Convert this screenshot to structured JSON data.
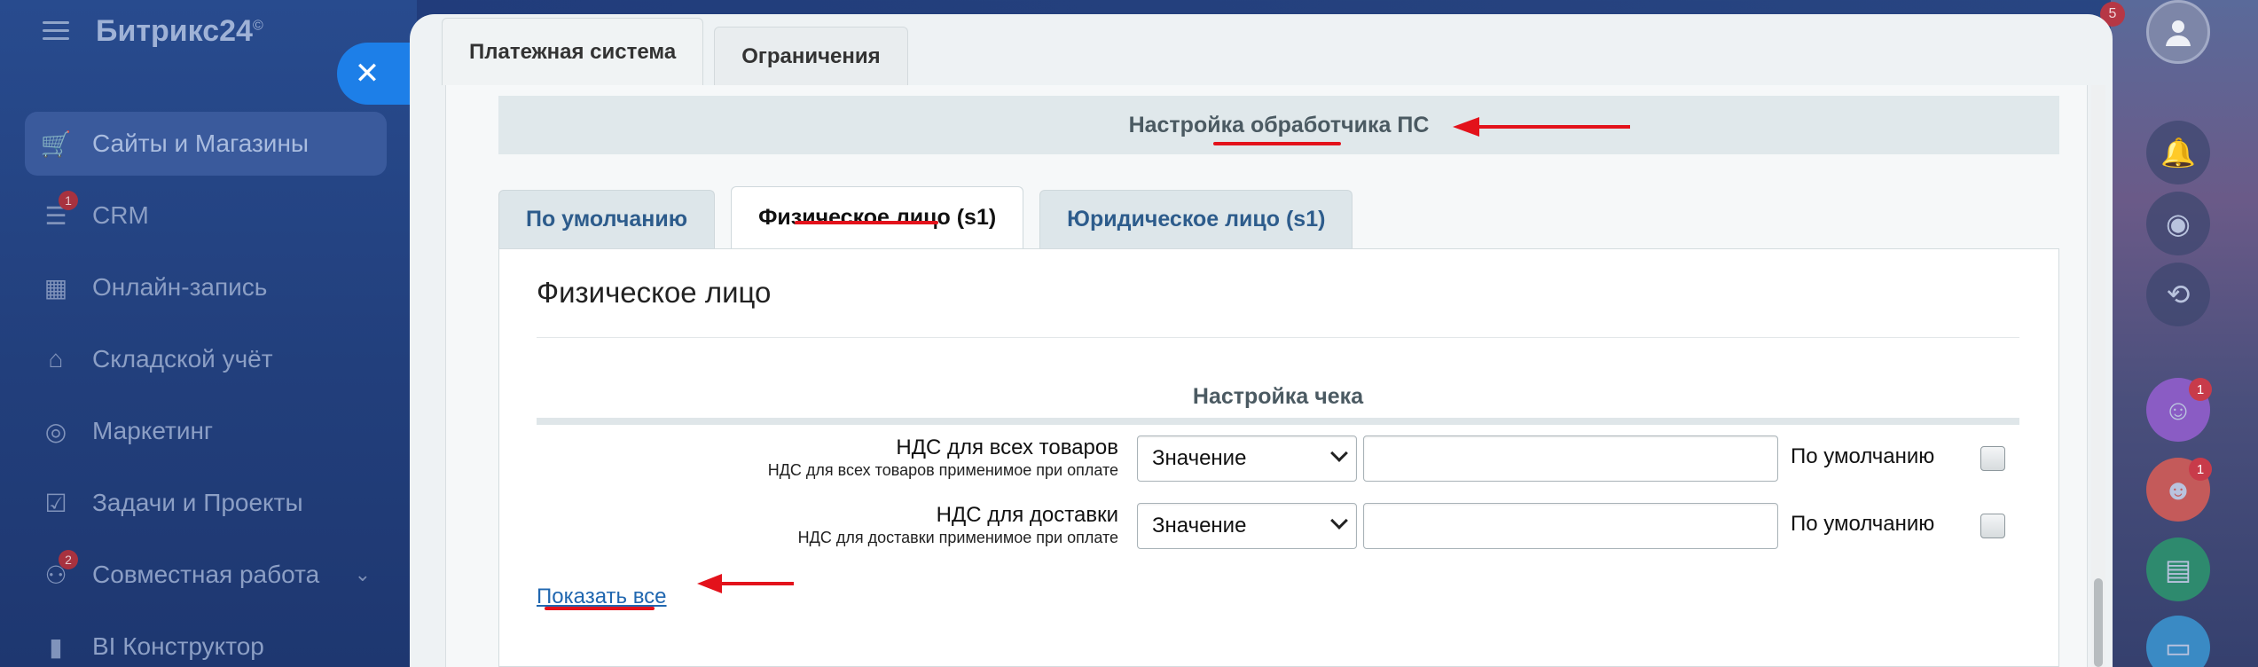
{
  "sidebar": {
    "logo": "Битрикс24",
    "logo_mark": "©",
    "items": [
      {
        "label": "Сайты и Магазины",
        "icon": "cart-icon",
        "badge": "",
        "active": true
      },
      {
        "label": "CRM",
        "icon": "crm-funnel-icon",
        "badge": "1"
      },
      {
        "label": "Онлайн-запись",
        "icon": "calendar-icon",
        "badge": ""
      },
      {
        "label": "Складской учёт",
        "icon": "warehouse-icon",
        "badge": ""
      },
      {
        "label": "Маркетинг",
        "icon": "target-icon",
        "badge": ""
      },
      {
        "label": "Задачи и Проекты",
        "icon": "checkbox-icon",
        "badge": ""
      },
      {
        "label": "Совместная работа",
        "icon": "collaboration-icon",
        "badge": "2"
      },
      {
        "label": "BI Конструктор",
        "icon": "bar-chart-icon",
        "badge": ""
      }
    ]
  },
  "panel": {
    "top_tabs": [
      "Платежная система",
      "Ограничения"
    ],
    "section_header": "Настройка обработчика ПС",
    "inner_tabs": [
      "По умолчанию",
      "Физическое лицо (s1)",
      "Юридическое лицо (s1)"
    ],
    "body_title": "Физическое лицо",
    "subsection_title": "Настройка чека",
    "fields": [
      {
        "label": "НДС для всех товаров",
        "hint": "НДС для всех товаров применимое при оплате",
        "select_value": "Значение",
        "input_value": "",
        "default_label": "По умолчанию"
      },
      {
        "label": "НДС для доставки",
        "hint": "НДС для доставки применимое при оплате",
        "select_value": "Значение",
        "input_value": "",
        "default_label": "По умолчанию"
      }
    ],
    "show_all_link": "Показать все"
  },
  "right_rail": {
    "top_badge": "5",
    "avatar_badges": [
      "1",
      "1"
    ]
  },
  "colors": {
    "accent_blue": "#1d7fe8",
    "link": "#2067b0",
    "annotation_red": "#e3121b"
  }
}
